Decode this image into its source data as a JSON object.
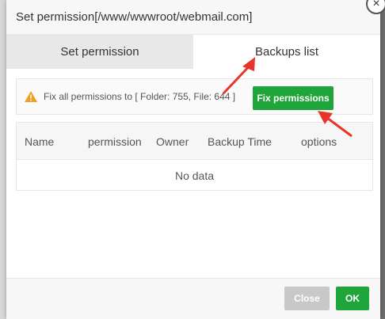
{
  "dialog": {
    "title": "Set permission[/www/wwwroot/webmail.com]",
    "close_icon": "×"
  },
  "tabs": [
    {
      "label": "Set permission",
      "active": false
    },
    {
      "label": "Backups list",
      "active": true
    }
  ],
  "fix_bar": {
    "icon": "warning-icon",
    "text": "Fix all permissions to [ Folder: 755, File: 644 ]",
    "button_label": "Fix permissions"
  },
  "table": {
    "columns": [
      "Name",
      "permission",
      "Owner",
      "Backup Time",
      "options"
    ],
    "empty_text": "No data"
  },
  "footer": {
    "close_label": "Close",
    "ok_label": "OK"
  },
  "colors": {
    "accent_green": "#20a53a",
    "annotation_red": "#e8352a"
  }
}
